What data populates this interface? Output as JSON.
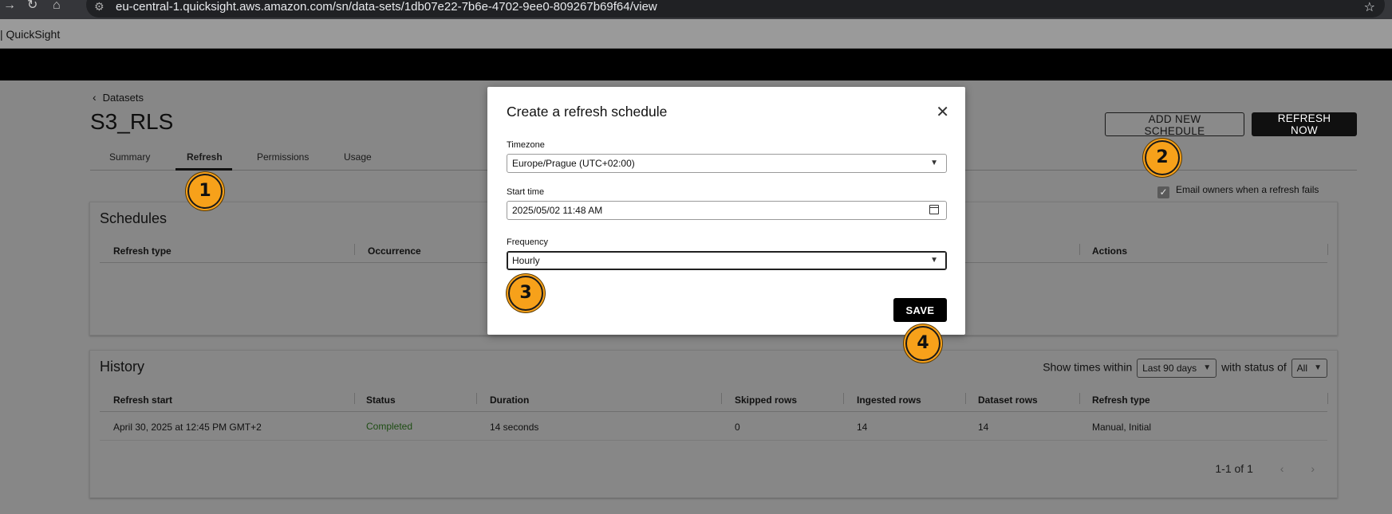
{
  "browser": {
    "url": "eu-central-1.quicksight.aws.amazon.com/sn/data-sets/1db07e22-7b6e-4702-9ee0-809267b69f64/view",
    "bookmark_label": "| QuickSight"
  },
  "breadcrumb": {
    "back_label": "Datasets"
  },
  "page_title": "S3_RLS",
  "tabs": [
    {
      "label": "Summary"
    },
    {
      "label": "Refresh"
    },
    {
      "label": "Permissions"
    },
    {
      "label": "Usage"
    }
  ],
  "actions": {
    "add_schedule": "ADD NEW SCHEDULE",
    "refresh_now": "REFRESH NOW"
  },
  "email_owners": {
    "label": "Email owners when a refresh fails",
    "checked": true
  },
  "schedules": {
    "title": "Schedules",
    "columns": [
      "Refresh type",
      "Occurrence",
      "Actions"
    ]
  },
  "history": {
    "title": "History",
    "filter": {
      "show_label": "Show times within",
      "range_value": "Last 90 days",
      "status_label": "with status of",
      "status_value": "All"
    },
    "columns": [
      "Refresh start",
      "Status",
      "Duration",
      "Skipped rows",
      "Ingested rows",
      "Dataset rows",
      "Refresh type"
    ],
    "rows": [
      {
        "refresh_start": "April 30, 2025 at 12:45 PM GMT+2",
        "status": "Completed",
        "duration": "14 seconds",
        "skipped_rows": "0",
        "ingested_rows": "14",
        "dataset_rows": "14",
        "refresh_type": "Manual, Initial"
      }
    ],
    "pagination": "1-1 of 1"
  },
  "modal": {
    "title": "Create a refresh schedule",
    "timezone_label": "Timezone",
    "timezone_value": "Europe/Prague (UTC+02:00)",
    "start_label": "Start time",
    "start_value": "2025/05/02 11:48 AM",
    "frequency_label": "Frequency",
    "frequency_value": "Hourly",
    "save_label": "SAVE"
  },
  "steps": [
    "1",
    "2",
    "3",
    "4"
  ],
  "colors": {
    "step_marker": "#f7a11a",
    "status_completed": "#1e4d14",
    "primary_button": "#000000"
  }
}
